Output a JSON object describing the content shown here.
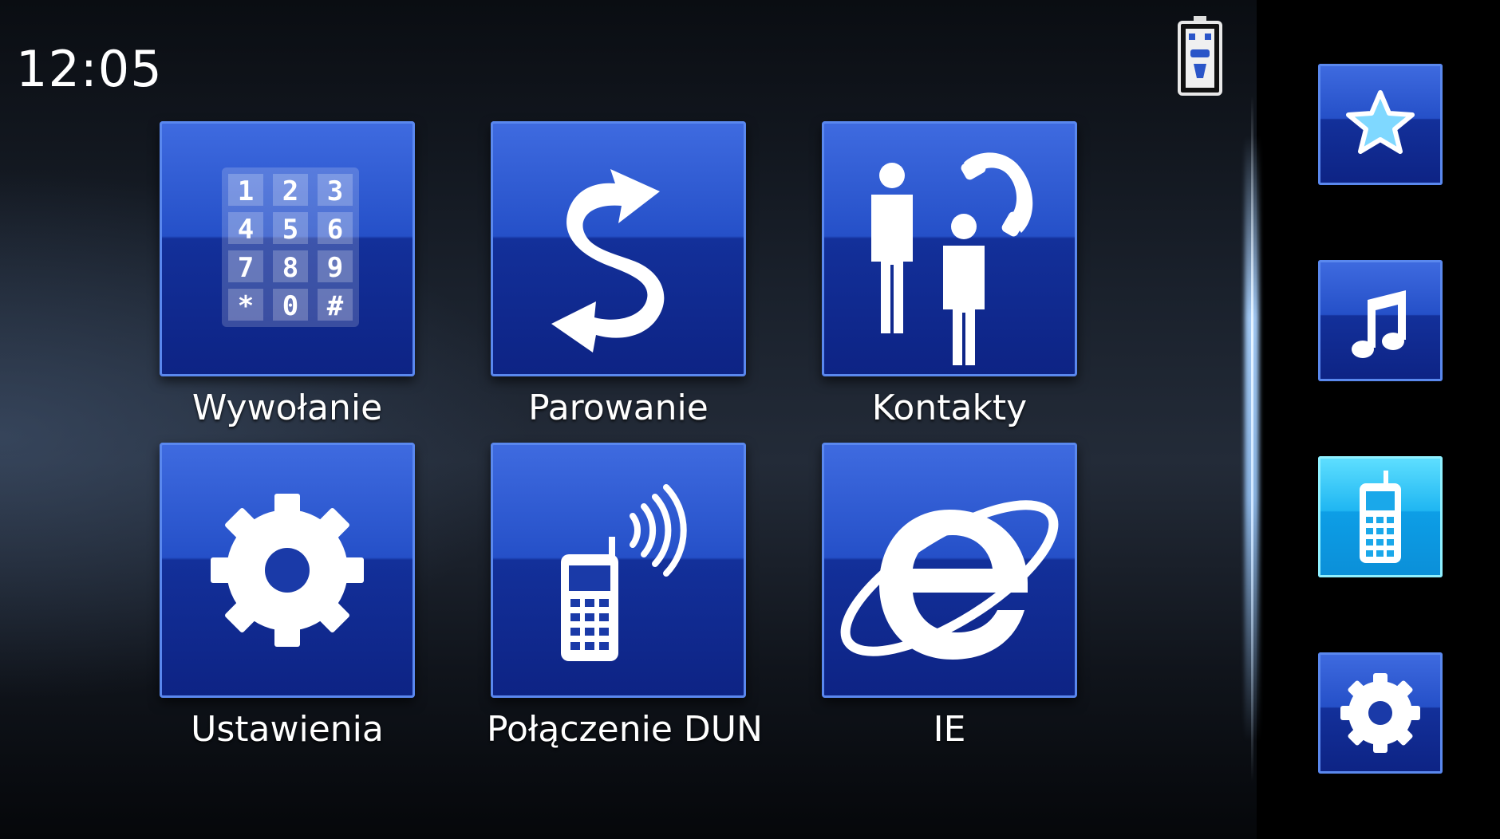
{
  "status_bar": {
    "time": "12:05",
    "battery_icon": "battery-icon"
  },
  "menu": {
    "tiles": [
      {
        "label": "Wywołanie",
        "icon": "dialpad-icon"
      },
      {
        "label": "Parowanie",
        "icon": "sync-arrows-icon"
      },
      {
        "label": "Kontakty",
        "icon": "contacts-icon"
      },
      {
        "label": "Ustawienia",
        "icon": "gear-icon"
      },
      {
        "label": "Połączenie DUN",
        "icon": "mobile-signal-icon"
      },
      {
        "label": "IE",
        "icon": "internet-explorer-icon"
      }
    ],
    "dialpad_keys": [
      "1",
      "2",
      "3",
      "4",
      "5",
      "6",
      "7",
      "8",
      "9",
      "*",
      "0",
      "#"
    ]
  },
  "sidebar": {
    "items": [
      {
        "icon": "star-icon",
        "active": false
      },
      {
        "icon": "music-note-icon",
        "active": false
      },
      {
        "icon": "mobile-phone-icon",
        "active": true
      },
      {
        "icon": "gear-icon",
        "active": false
      }
    ]
  },
  "colors": {
    "tile_blue": "#2550c8",
    "tile_dark": "#0d2384",
    "active_cyan": "#1fb6f2",
    "text": "#ffffff"
  }
}
